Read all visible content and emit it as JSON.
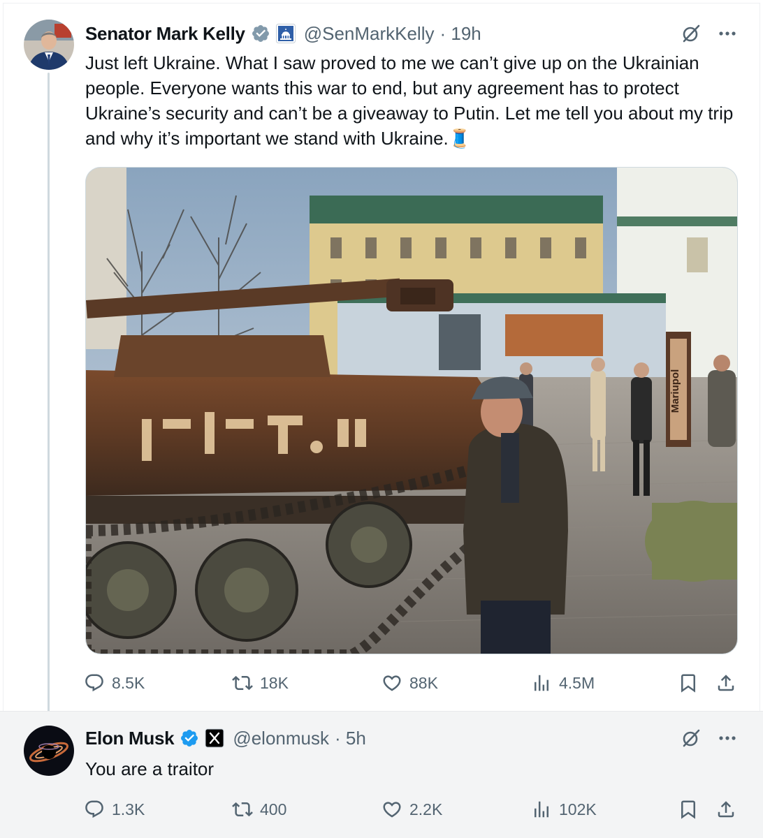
{
  "tweets": [
    {
      "author": "Senator Mark Kelly",
      "handle": "@SenMarkKelly",
      "time": "· 19h",
      "text": "Just left Ukraine. What I saw proved to me we can’t give up on the Ukrainian people. Everyone wants this war to end, but any agreement has to protect Ukraine’s security and can’t be a giveaway to Putin. Let me tell you about my trip and why it’s important we stand with Ukraine.🧵",
      "affiliation_icon": "capitol-building-icon",
      "media_text": {
        "sign": "Mariupol"
      },
      "stats": {
        "replies": "8.5K",
        "reposts": "18K",
        "likes": "88K",
        "views": "4.5M"
      }
    },
    {
      "author": "Elon Musk",
      "handle": "@elonmusk",
      "time": "· 5h",
      "text": "You are a traitor",
      "affiliation_icon": "x-logo-icon",
      "stats": {
        "replies": "1.3K",
        "reposts": "400",
        "likes": "2.2K",
        "views": "102K"
      }
    }
  ],
  "colors": {
    "verified": "#1d9bf0",
    "muted": "#536471",
    "text": "#0f1419",
    "thread_line": "#cfd9de"
  }
}
